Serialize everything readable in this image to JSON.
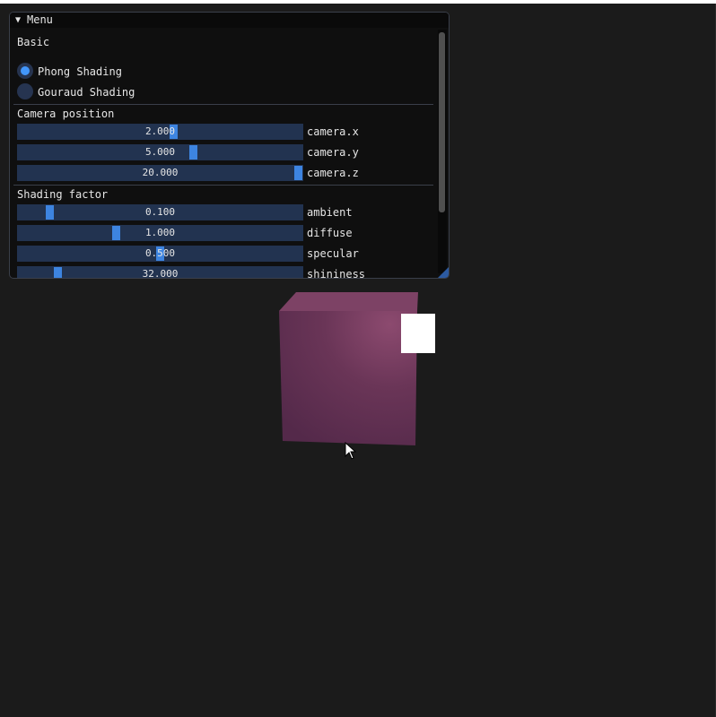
{
  "menu": {
    "title": "Menu",
    "basic": {
      "header": "Basic",
      "options": [
        {
          "label": "Phong Shading",
          "selected": true
        },
        {
          "label": "Gouraud Shading",
          "selected": false
        }
      ]
    },
    "camera": {
      "header": "Camera position",
      "sliders": [
        {
          "value": "2.000",
          "label": "camera.x",
          "fraction": 0.55
        },
        {
          "value": "5.000",
          "label": "camera.y",
          "fraction": 0.62
        },
        {
          "value": "20.000",
          "label": "camera.z",
          "fraction": 1.0
        }
      ]
    },
    "shading": {
      "header": "Shading factor",
      "sliders": [
        {
          "value": "0.100",
          "label": "ambient",
          "fraction": 0.1
        },
        {
          "value": "1.000",
          "label": "diffuse",
          "fraction": 0.34
        },
        {
          "value": "0.500",
          "label": "specular",
          "fraction": 0.5
        },
        {
          "value": "32.000",
          "label": "shininess",
          "fraction": 0.13
        }
      ]
    }
  },
  "colors": {
    "accent": "#4296fa",
    "slider_bg": "#223350",
    "slider_grab": "#3d84e0",
    "cube_face": "#5e2f4c",
    "light": "#ffffff",
    "background": "#1b1b1b"
  },
  "icons": {
    "collapse": "triangle-down-icon",
    "cursor": "mouse-pointer-icon"
  }
}
